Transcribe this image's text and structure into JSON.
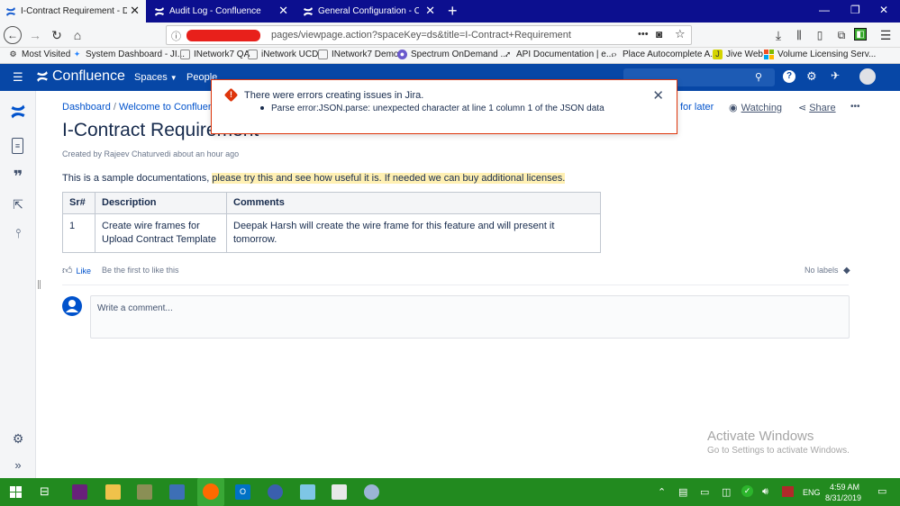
{
  "browser": {
    "tabs": [
      {
        "title": "I-Contract Requirement - Demo",
        "active": true
      },
      {
        "title": "Audit Log - Confluence",
        "active": false
      },
      {
        "title": "General Configuration - Confluence",
        "active": false
      }
    ],
    "url": "pages/viewpage.action?spaceKey=ds&title=I-Contract+Requirement",
    "url_more": "•••",
    "bookmarks": [
      {
        "label": "Most Visited",
        "icon": "gear-icon"
      },
      {
        "label": "System Dashboard - JI...",
        "icon": "jira-icon"
      },
      {
        "label": "INetwork7 QA",
        "icon": "page-icon"
      },
      {
        "label": "iNetwork UCD",
        "icon": "page-icon"
      },
      {
        "label": "INetwork7 Demo",
        "icon": "page-icon"
      },
      {
        "label": "Spectrum OnDemand ...",
        "icon": "globe-icon"
      },
      {
        "label": "API Documentation | e...",
        "icon": "api-icon"
      },
      {
        "label": "Place Autocomplete A...",
        "icon": "code-icon"
      },
      {
        "label": "Jive Web",
        "icon": "jive-icon"
      },
      {
        "label": "Volume Licensing Serv...",
        "icon": "windows-icon"
      }
    ]
  },
  "confluence": {
    "product_name": "Confluence",
    "nav": {
      "spaces": "Spaces",
      "people": "People"
    }
  },
  "breadcrumbs": [
    "Dashboard",
    "Welcome to Confluence"
  ],
  "page": {
    "title": "I-Contract Requirement",
    "byline": "Created by Rajeev Chaturvedi about an hour ago",
    "body_plain": "This is a sample documentations,",
    "body_highlight": "please try this and see how useful it is. If needed we can buy additional licenses.",
    "actions": {
      "save_for_later": "for later",
      "watching": "Watching",
      "share": "Share",
      "more": "•••"
    }
  },
  "table": {
    "headers": [
      "Sr#",
      "Description",
      "Comments"
    ],
    "rows": [
      {
        "sr": "1",
        "description_1": "Create wire frames for",
        "description_2": "Upload Contract Template",
        "comments": "Deepak Harsh will create the wire frame for this feature and will present it tomorrow."
      }
    ]
  },
  "footer": {
    "like": "Like",
    "first_like": "Be the first to like this",
    "labels": "No labels",
    "comment_placeholder": "Write a comment..."
  },
  "error_flag": {
    "title": "There were errors creating issues in Jira.",
    "detail": "Parse error:JSON.parse: unexpected character at line 1 column 1 of the JSON data"
  },
  "watermark": {
    "line1": "Activate Windows",
    "line2": "Go to Settings to activate Windows."
  },
  "taskbar": {
    "time": "4:59 AM",
    "date": "8/31/2019",
    "language": "ENG"
  },
  "colors": {
    "tabbar": "#0c0f8f",
    "confluence_header": "#0747a6",
    "taskbar": "#228a1f",
    "error": "#de350b",
    "highlight": "#fff0b3"
  }
}
